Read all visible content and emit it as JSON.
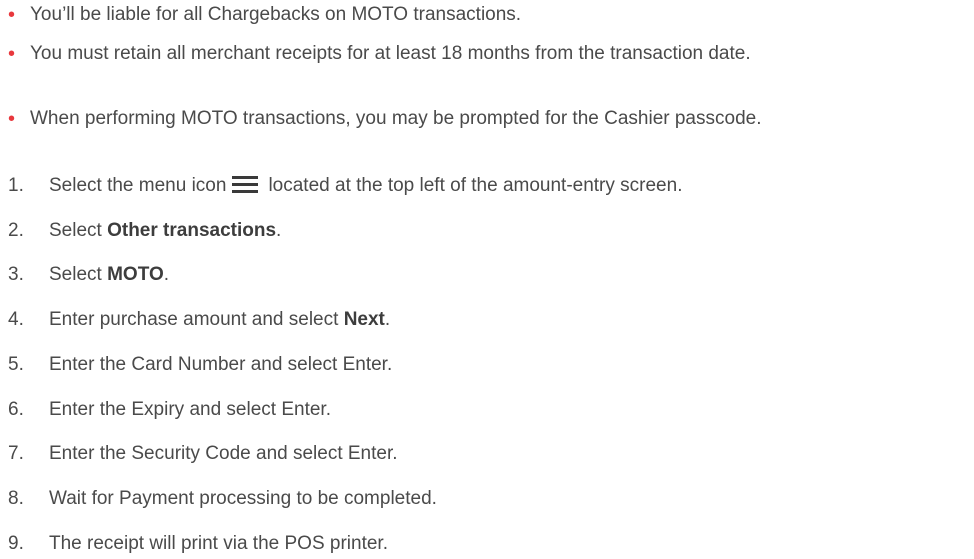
{
  "bullets": [
    "You’ll be liable for all Chargebacks on MOTO transactions.",
    "You must retain all merchant receipts for at least 18 months from the transaction date.",
    "When performing MOTO transactions, you may be prompted for the Cashier passcode."
  ],
  "bullet_marker": "•",
  "accent_color": "#e8383d",
  "steps": [
    {
      "num": "1.",
      "before": "Select the menu icon",
      "after": "located at the top left of the amount-entry screen.",
      "icon": "hamburger-menu-icon"
    },
    {
      "num": "2.",
      "before": "Select ",
      "bold": "Other transactions",
      "after": "."
    },
    {
      "num": "3.",
      "before": "Select ",
      "bold": "MOTO",
      "after": "."
    },
    {
      "num": "4.",
      "before": "Enter purchase amount and select ",
      "bold": "Next",
      "after": "."
    },
    {
      "num": "5.",
      "text": "Enter the Card Number and select Enter."
    },
    {
      "num": "6.",
      "text": "Enter the Expiry and select Enter."
    },
    {
      "num": "7.",
      "text": "Enter the Security Code and select Enter."
    },
    {
      "num": "8.",
      "text": "Wait for Payment processing to be completed."
    },
    {
      "num": "9.",
      "text": "The receipt will print via the POS printer."
    }
  ]
}
